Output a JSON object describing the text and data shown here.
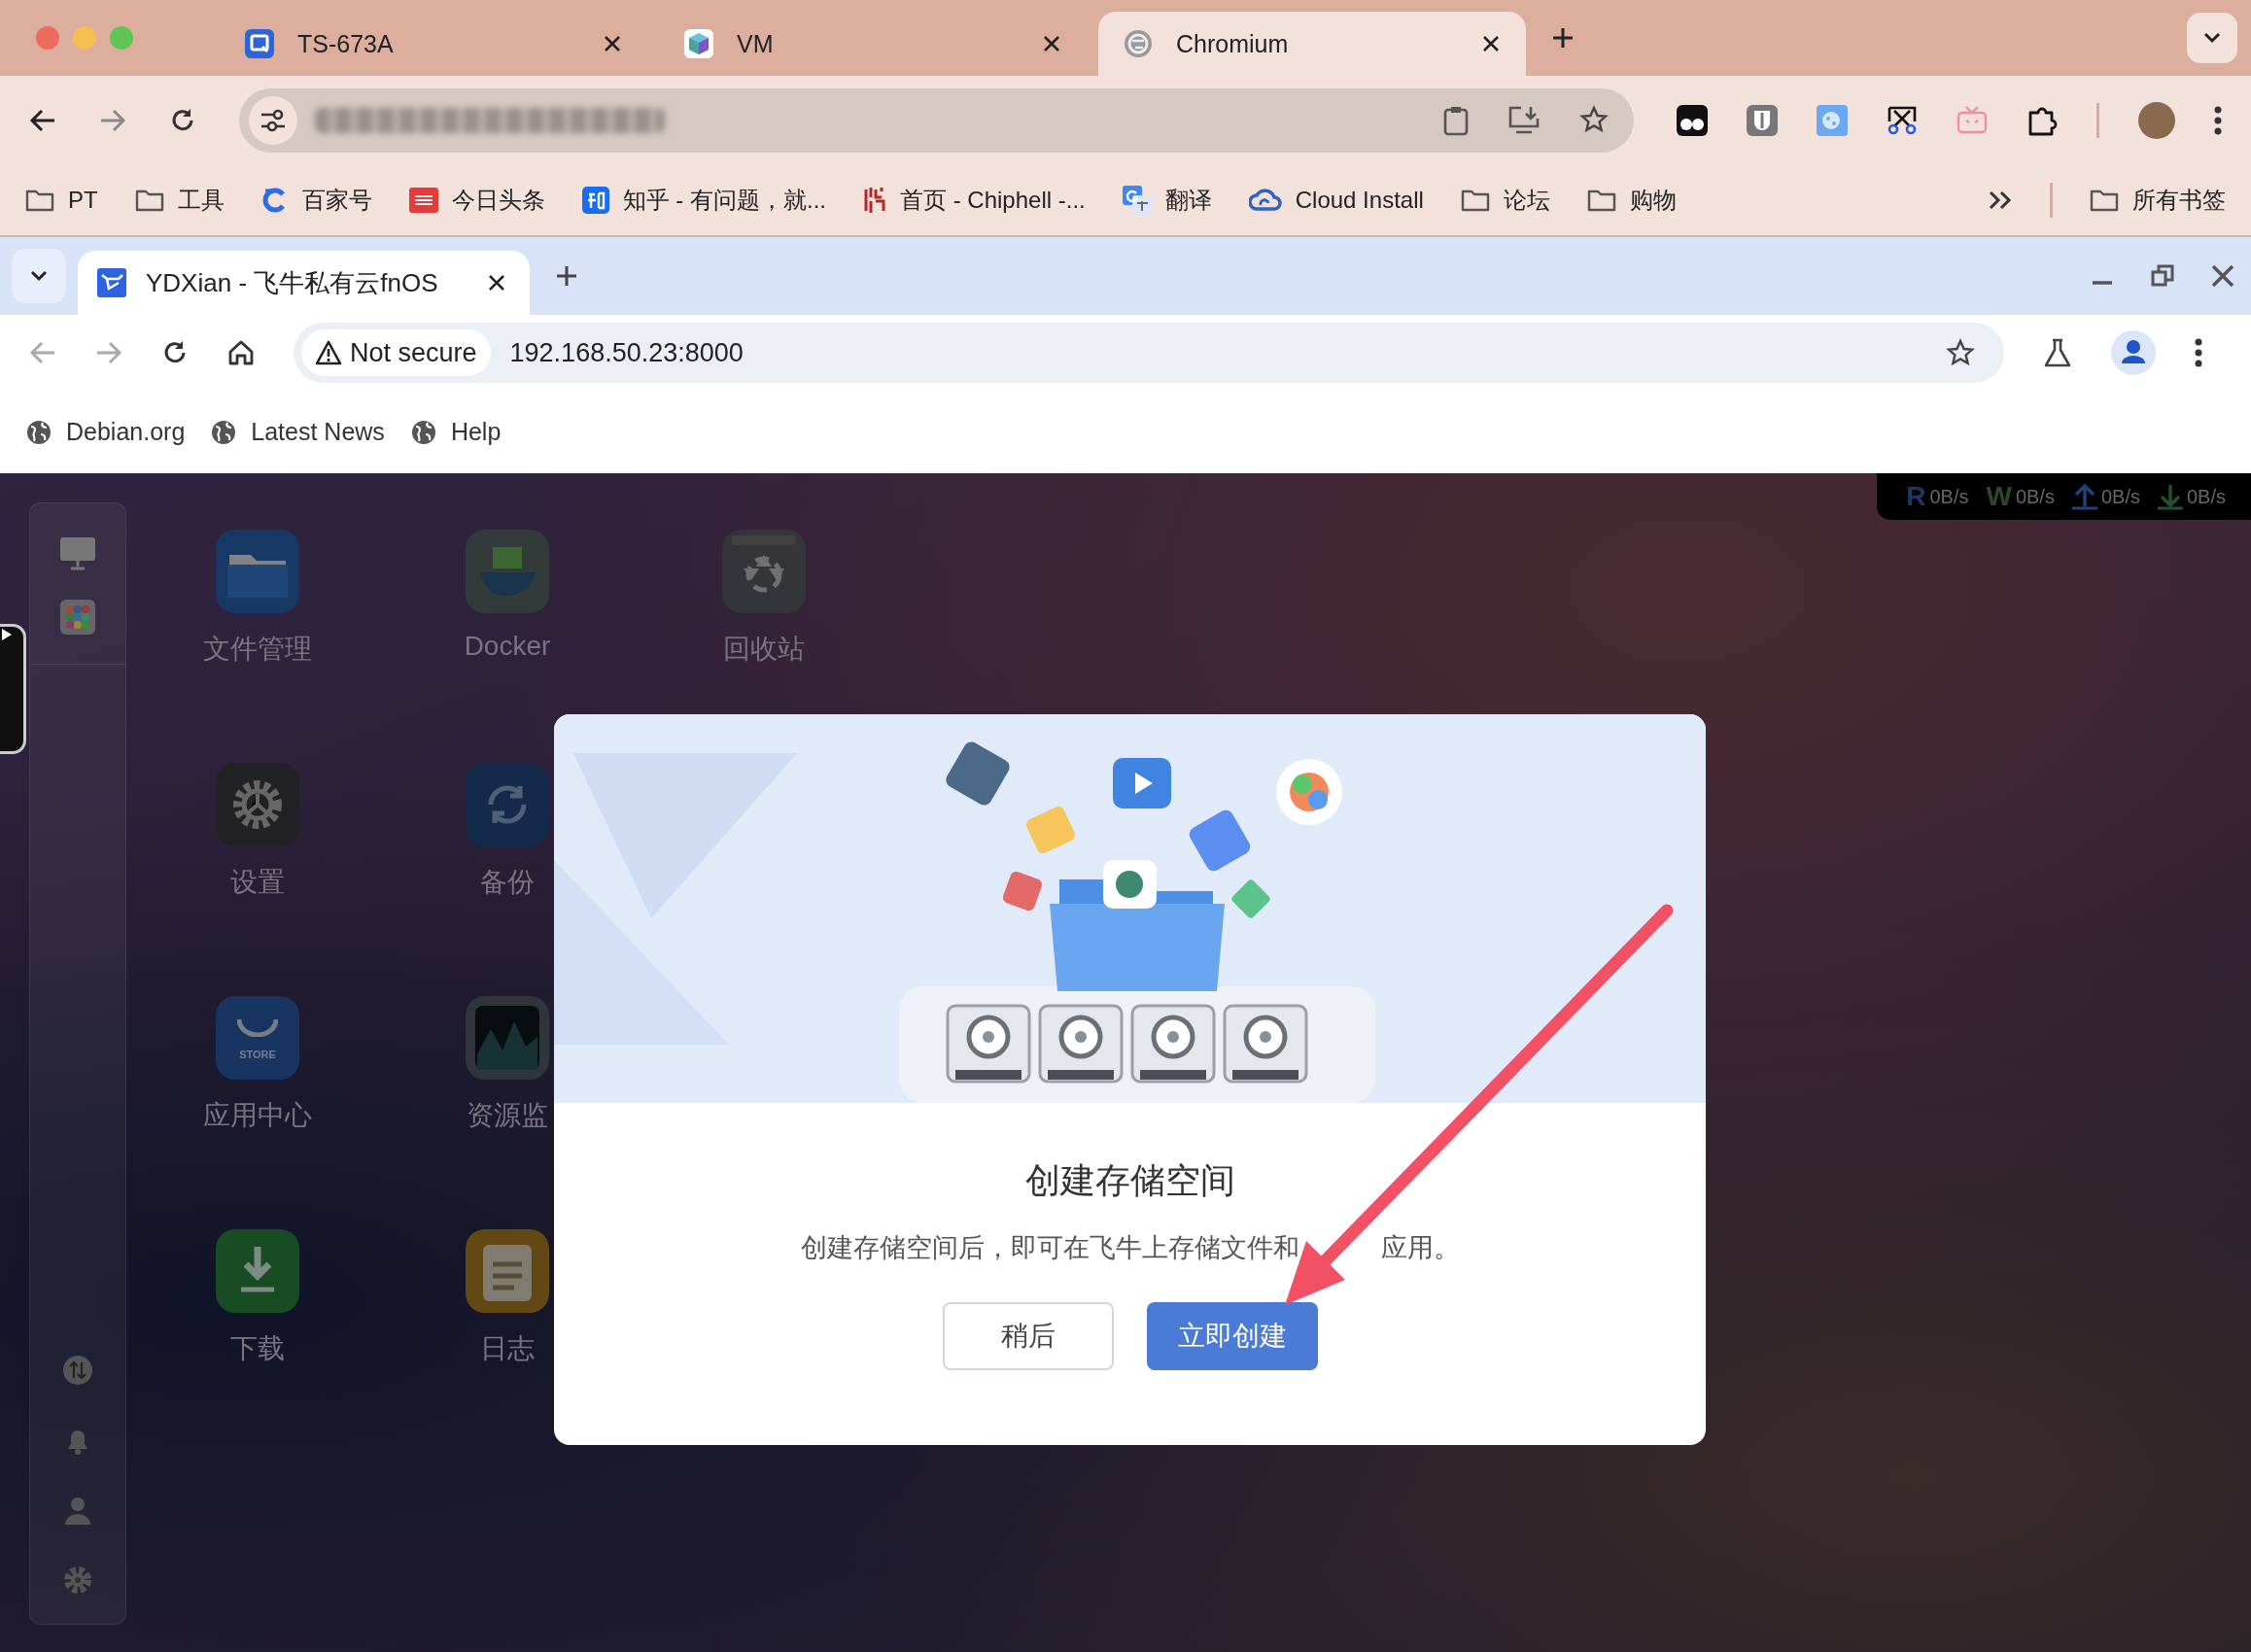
{
  "outer_browser": {
    "tabs": [
      {
        "title": "TS-673A",
        "kind": "square",
        "selected": false
      },
      {
        "title": "VM",
        "kind": "cube",
        "selected": false
      },
      {
        "title": "Chromium",
        "kind": "emblem",
        "selected": true
      }
    ],
    "bookmarks": [
      {
        "label": "PT",
        "kind": "folder"
      },
      {
        "label": "工具",
        "kind": "folder"
      },
      {
        "label": "百家号",
        "kind": "ring"
      },
      {
        "label": "今日头条",
        "kind": "red"
      },
      {
        "label": "知乎 - 有问题，就...",
        "kind": "blue"
      },
      {
        "label": "首页 - Chiphell -...",
        "kind": "pattern"
      },
      {
        "label": "翻译",
        "kind": "translate"
      },
      {
        "label": "Cloud Install",
        "kind": "cloud"
      },
      {
        "label": "论坛",
        "kind": "folder"
      },
      {
        "label": "购物",
        "kind": "folder"
      }
    ],
    "all_bookmarks": "所有书签"
  },
  "inner_browser": {
    "tab": {
      "title": "YDXian - 飞牛私有云fnOS"
    },
    "security": "Not secure",
    "url": "192.168.50.23:8000",
    "bookmarks": [
      "Debian.org",
      "Latest News",
      "Help"
    ]
  },
  "stats": [
    {
      "kind": "read",
      "label": "R",
      "value": "0B/s"
    },
    {
      "kind": "write",
      "label": "W",
      "value": "0B/s"
    },
    {
      "kind": "upload",
      "value": "0B/s"
    },
    {
      "kind": "download",
      "value": "0B/s"
    }
  ],
  "desktop_apps": [
    {
      "name": "文件管理",
      "kind": "files"
    },
    {
      "name": "设置",
      "kind": "settings"
    },
    {
      "name": "应用中心",
      "kind": "store",
      "icon_text": "STORE"
    },
    {
      "name": "下载",
      "kind": "download"
    },
    {
      "name": "Docker",
      "kind": "docker"
    },
    {
      "name": "备份",
      "kind": "backup"
    },
    {
      "name": "资源监",
      "kind": "monitor"
    },
    {
      "name": "日志",
      "kind": "log"
    },
    {
      "name": "回收站",
      "kind": "trash"
    }
  ],
  "dialog": {
    "title": "创建存储空间",
    "message_parts": [
      "创建存储空间后，即可在飞牛上存储文件和",
      "应用。"
    ],
    "buttons": [
      {
        "label": "稍后",
        "kind": "secondary"
      },
      {
        "label": "立即创建",
        "kind": "primary"
      }
    ]
  }
}
